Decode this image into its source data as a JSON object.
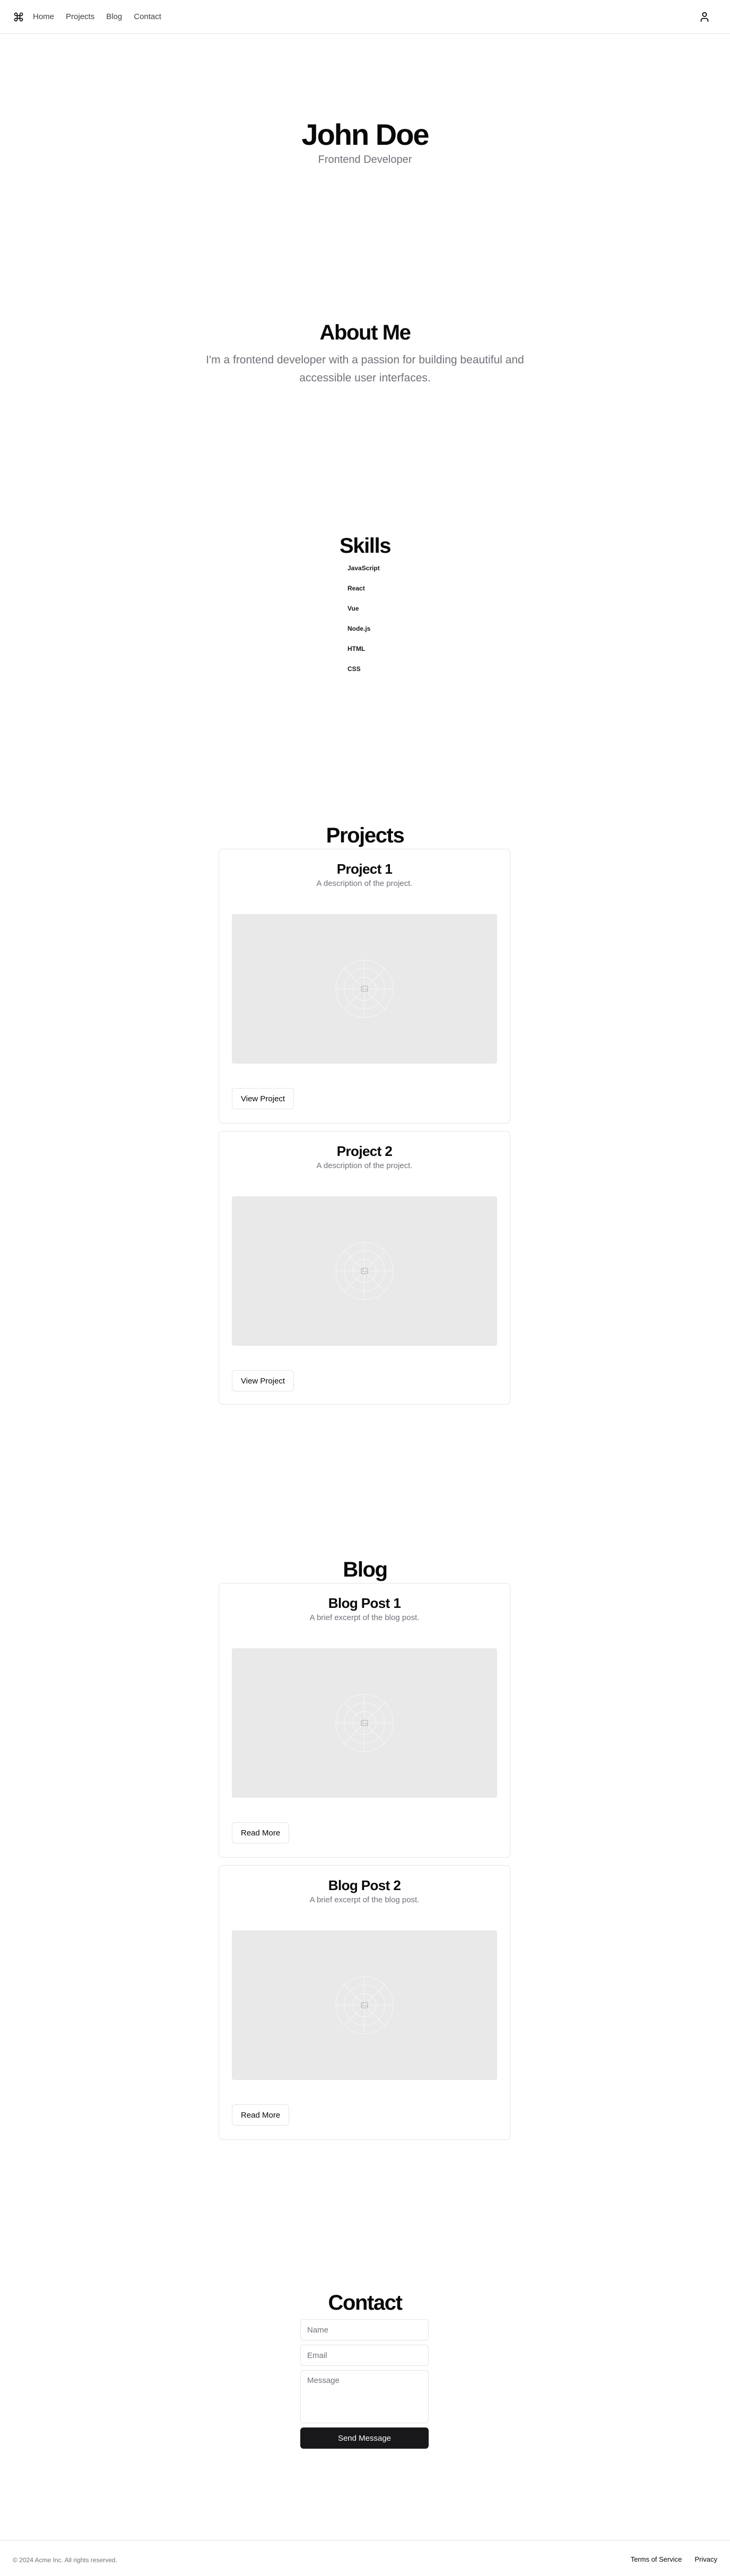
{
  "header": {
    "logo_icon": "command-icon",
    "nav": [
      {
        "label": "Home"
      },
      {
        "label": "Projects"
      },
      {
        "label": "Blog"
      },
      {
        "label": "Contact"
      }
    ],
    "user_icon": "user-icon"
  },
  "hero": {
    "name": "John Doe",
    "role": "Frontend Developer"
  },
  "about": {
    "title": "About Me",
    "text": "I'm a frontend developer with a passion for building beautiful and accessible user interfaces."
  },
  "skills": {
    "title": "Skills",
    "items": [
      "JavaScript",
      "React",
      "Vue",
      "Node.js",
      "HTML",
      "CSS"
    ]
  },
  "projects": {
    "title": "Projects",
    "items": [
      {
        "title": "Project 1",
        "description": "A description of the project.",
        "button": "View Project",
        "image_icon": "image-placeholder-icon"
      },
      {
        "title": "Project 2",
        "description": "A description of the project.",
        "button": "View Project",
        "image_icon": "image-placeholder-icon"
      }
    ]
  },
  "blog": {
    "title": "Blog",
    "items": [
      {
        "title": "Blog Post 1",
        "description": "A brief excerpt of the blog post.",
        "button": "Read More",
        "image_icon": "image-placeholder-icon"
      },
      {
        "title": "Blog Post 2",
        "description": "A brief excerpt of the blog post.",
        "button": "Read More",
        "image_icon": "image-placeholder-icon"
      }
    ]
  },
  "contact": {
    "title": "Contact",
    "name_placeholder": "Name",
    "email_placeholder": "Email",
    "message_placeholder": "Message",
    "submit": "Send Message"
  },
  "footer": {
    "copyright": "© 2024 Acme Inc. All rights reserved.",
    "links": [
      {
        "label": "Terms of Service"
      },
      {
        "label": "Privacy"
      }
    ]
  },
  "colors": {
    "primary": "#18181b",
    "muted_text": "#71717a",
    "border": "#e4e4e7",
    "placeholder_bg": "#e9e9e9"
  }
}
